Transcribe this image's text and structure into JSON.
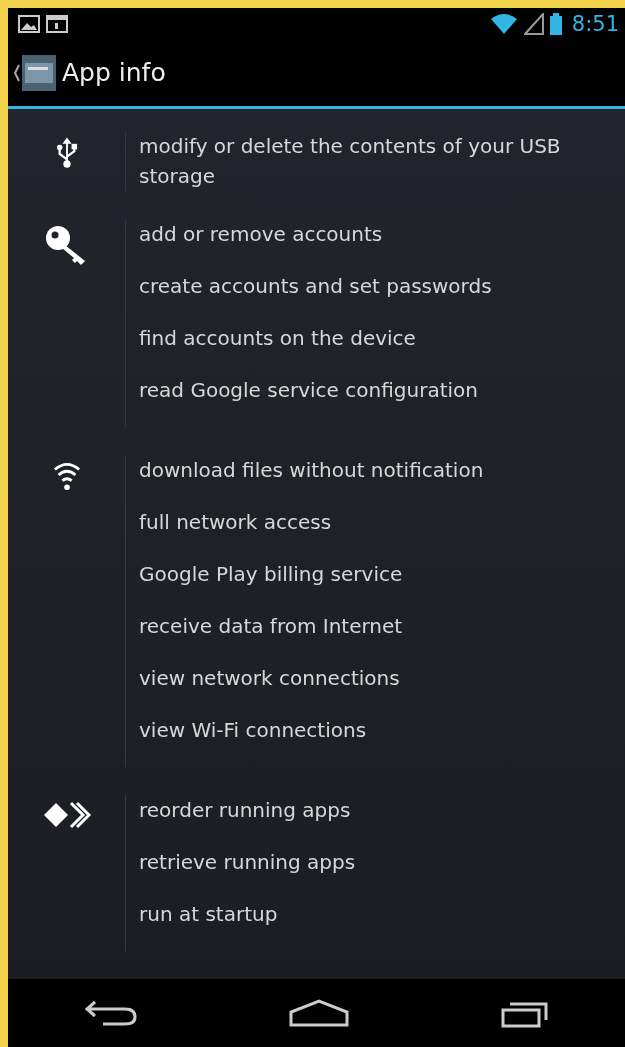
{
  "status_bar": {
    "time": "8:51"
  },
  "action_bar": {
    "title": "App info"
  },
  "groups": [
    {
      "permissions": [
        "modify or delete the contents of your USB storage"
      ]
    },
    {
      "permissions": [
        "add or remove accounts",
        "create accounts and set passwords",
        "find accounts on the device",
        "read Google service configuration"
      ]
    },
    {
      "permissions": [
        "download files without notification",
        "full network access",
        "Google Play billing service",
        "receive data from Internet",
        "view network connections",
        "view Wi-Fi connections"
      ]
    },
    {
      "permissions": [
        "reorder running apps",
        "retrieve running apps",
        "run at startup"
      ]
    }
  ]
}
